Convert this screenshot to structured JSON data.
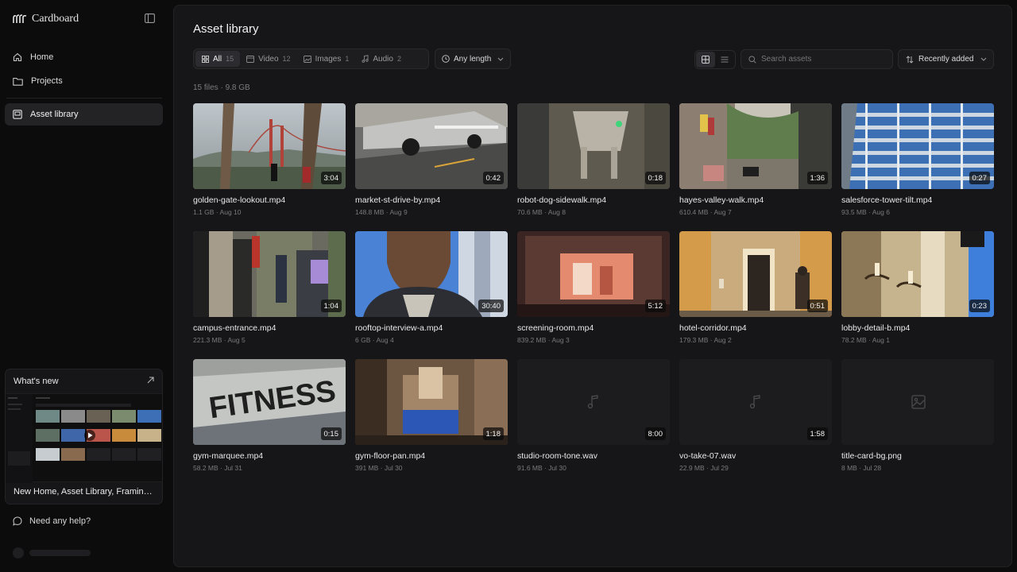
{
  "app": {
    "brand": "Cardboard"
  },
  "sidebar": {
    "items": [
      {
        "label": "Home",
        "icon": "home-icon"
      },
      {
        "label": "Projects",
        "icon": "folder-icon"
      },
      {
        "label": "Asset library",
        "icon": "library-icon",
        "active": true
      }
    ],
    "whats_new": {
      "title": "What's new",
      "caption": "New Home, Asset Library, Framing Re..."
    },
    "help": "Need any help?"
  },
  "main": {
    "title": "Asset library",
    "filters": [
      {
        "label": "All",
        "count": "15",
        "icon": "grid-icon",
        "active": true
      },
      {
        "label": "Video",
        "count": "12",
        "icon": "video-icon"
      },
      {
        "label": "Images",
        "count": "1",
        "icon": "image-icon"
      },
      {
        "label": "Audio",
        "count": "2",
        "icon": "music-icon"
      }
    ],
    "length_filter": "Any length",
    "search": {
      "placeholder": "Search assets",
      "value": ""
    },
    "sort": "Recently added",
    "view": "grid",
    "summary": "15 files · 9.8 GB"
  },
  "assets": [
    {
      "name": "golden-gate-lookout.mp4",
      "meta": "1.1 GB · Aug 10",
      "duration": "3:04",
      "kind": "video"
    },
    {
      "name": "market-st-drive-by.mp4",
      "meta": "148.8 MB · Aug 9",
      "duration": "0:42",
      "kind": "video"
    },
    {
      "name": "robot-dog-sidewalk.mp4",
      "meta": "70.6 MB · Aug 8",
      "duration": "0:18",
      "kind": "video"
    },
    {
      "name": "hayes-valley-walk.mp4",
      "meta": "610.4 MB · Aug 7",
      "duration": "1:36",
      "kind": "video"
    },
    {
      "name": "salesforce-tower-tilt.mp4",
      "meta": "93.5 MB · Aug 6",
      "duration": "0:27",
      "kind": "video"
    },
    {
      "name": "campus-entrance.mp4",
      "meta": "221.3 MB · Aug 5",
      "duration": "1:04",
      "kind": "video"
    },
    {
      "name": "rooftop-interview-a.mp4",
      "meta": "6 GB · Aug 4",
      "duration": "30:40",
      "kind": "video"
    },
    {
      "name": "screening-room.mp4",
      "meta": "839.2 MB · Aug 3",
      "duration": "5:12",
      "kind": "video"
    },
    {
      "name": "hotel-corridor.mp4",
      "meta": "179.3 MB · Aug 2",
      "duration": "0:51",
      "kind": "video"
    },
    {
      "name": "lobby-detail-b.mp4",
      "meta": "78.2 MB · Aug 1",
      "duration": "0:23",
      "kind": "video"
    },
    {
      "name": "gym-marquee.mp4",
      "meta": "58.2 MB · Jul 31",
      "duration": "0:15",
      "kind": "video",
      "overlay_text": "FITNESS"
    },
    {
      "name": "gym-floor-pan.mp4",
      "meta": "391 MB · Jul 30",
      "duration": "1:18",
      "kind": "video"
    },
    {
      "name": "studio-room-tone.wav",
      "meta": "91.6 MB · Jul 30",
      "duration": "8:00",
      "kind": "audio"
    },
    {
      "name": "vo-take-07.wav",
      "meta": "22.9 MB · Jul 29",
      "duration": "1:58",
      "kind": "audio"
    },
    {
      "name": "title-card-bg.png",
      "meta": "8 MB · Jul 28",
      "duration": "",
      "kind": "image"
    }
  ]
}
